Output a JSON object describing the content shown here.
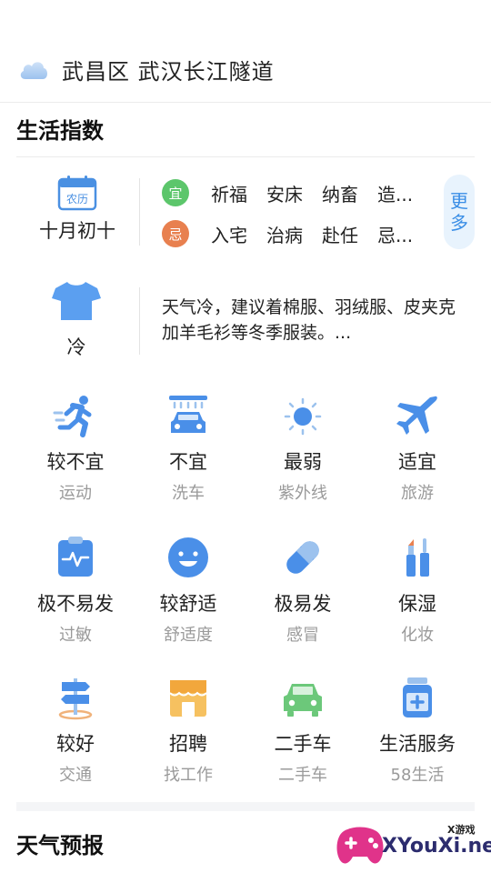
{
  "location": {
    "icon": "cloud-icon",
    "text": "武昌区  武汉长江隧道"
  },
  "life_index": {
    "title": "生活指数",
    "almanac": {
      "icon_label": "农历",
      "date": "十月初十",
      "yi_label": "宜",
      "yi_items": [
        "祈福",
        "安床",
        "纳畜",
        "造..."
      ],
      "ji_label": "忌",
      "ji_items": [
        "入宅",
        "治病",
        "赴任",
        "忌..."
      ],
      "more_label_1": "更",
      "more_label_2": "多"
    },
    "clothing": {
      "icon": "tshirt-icon",
      "label": "冷",
      "advice": "天气冷，建议着棉服、羽绒服、皮夹克加羊毛衫等冬季服装。..."
    },
    "grid": [
      {
        "icon": "running-icon",
        "value": "较不宜",
        "label": "运动"
      },
      {
        "icon": "car-wash-icon",
        "value": "不宜",
        "label": "洗车"
      },
      {
        "icon": "sun-icon",
        "value": "最弱",
        "label": "紫外线"
      },
      {
        "icon": "airplane-icon",
        "value": "适宜",
        "label": "旅游"
      },
      {
        "icon": "allergy-clipboard-icon",
        "value": "极不易发",
        "label": "过敏"
      },
      {
        "icon": "smiley-icon",
        "value": "较舒适",
        "label": "舒适度"
      },
      {
        "icon": "pill-icon",
        "value": "极易发",
        "label": "感冒"
      },
      {
        "icon": "makeup-icon",
        "value": "保湿",
        "label": "化妆"
      },
      {
        "icon": "signpost-icon",
        "value": "较好",
        "label": "交通"
      },
      {
        "icon": "shop-icon",
        "value": "招聘",
        "label": "找工作"
      },
      {
        "icon": "car-icon",
        "value": "二手车",
        "label": "二手车"
      },
      {
        "icon": "medicine-bottle-icon",
        "value": "生活服务",
        "label": "58生活"
      }
    ]
  },
  "forecast": {
    "title": "天气预报"
  },
  "watermark": {
    "tag": "X游戏",
    "text": "XYouXi.net"
  },
  "colors": {
    "accent_blue": "#3a8ee6",
    "yi_green": "#5cc66b",
    "ji_orange": "#e8804f",
    "label_gray": "#9a9a9a"
  }
}
